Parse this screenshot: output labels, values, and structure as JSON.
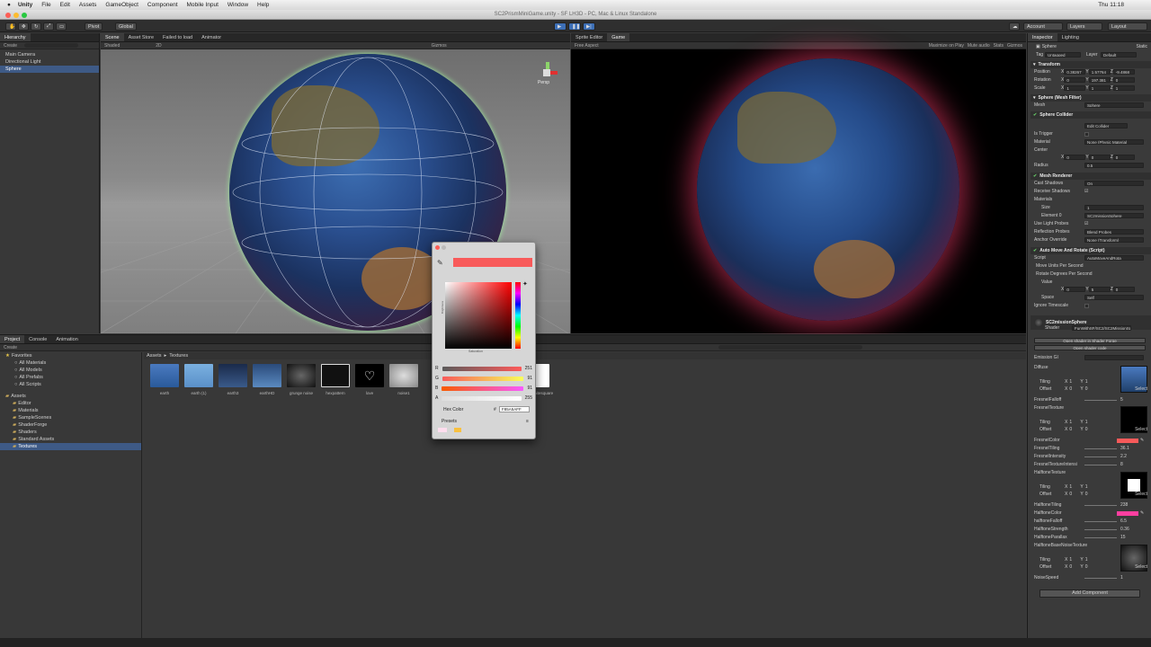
{
  "menubar": {
    "app": "Unity",
    "items": [
      "File",
      "Edit",
      "Assets",
      "GameObject",
      "Component",
      "Mobile Input",
      "Window",
      "Help"
    ],
    "title": "SC2PrismMiniGame.unity - SF LH3D - PC, Mac & Linux Standalone",
    "time": "Thu 11:18"
  },
  "toolbar": {
    "pivot": "Pivot",
    "global": "Global",
    "account": "Account",
    "layers": "Layers",
    "layout": "Layout"
  },
  "hierarchy": {
    "tab": "Hierarchy",
    "create": "Create",
    "items": [
      "Main Camera",
      "Directional Light",
      "Sphere"
    ]
  },
  "scene": {
    "tabs": [
      "Scene",
      "Asset Store",
      "Failed to load",
      "Animator"
    ],
    "shading": "Shaded",
    "mode": "2D",
    "gizmos": "Gizmos",
    "persp": "Persp"
  },
  "game": {
    "tabs": [
      "Sprite Editor",
      "Game"
    ],
    "aspect": "Free Aspect",
    "options": [
      "Maximize on Play",
      "Mute audio",
      "Stats",
      "Gizmos"
    ]
  },
  "project": {
    "tabs": [
      "Project",
      "Console",
      "Animation"
    ],
    "create": "Create",
    "favorites": "Favorites",
    "fav_items": [
      "All Materials",
      "All Models",
      "All Prefabs",
      "All Scripts"
    ],
    "assets": "Assets",
    "folders": [
      "Editor",
      "Materials",
      "SampleScenes",
      "ShaderForge",
      "Shaders",
      "Standard Assets",
      "Textures"
    ],
    "breadcrumb": [
      "Assets",
      "Textures"
    ],
    "thumbnails": [
      "earth",
      "earth (1)",
      "earth3",
      "earthHD",
      "grunge noise",
      "hexpattern",
      "love",
      "noise1",
      "",
      "whitesquare"
    ]
  },
  "color_picker": {
    "hex_label": "Hex Color",
    "hex_value": "F85A5AFF",
    "rgba": [
      {
        "channel": "R",
        "value": "251"
      },
      {
        "channel": "G",
        "value": "91"
      },
      {
        "channel": "B",
        "value": "91"
      },
      {
        "channel": "A",
        "value": "255"
      }
    ],
    "presets": "Presets",
    "saturation": "Saturation",
    "brightness": "Brightness",
    "current_color": "#f85a5a"
  },
  "inspector": {
    "tabs": [
      "Inspector",
      "Lighting"
    ],
    "object_name": "Sphere",
    "static": "Static",
    "tag_label": "Tag",
    "tag": "Untagged",
    "layer_label": "Layer",
    "layer": "Default",
    "transform": {
      "title": "Transform",
      "position": {
        "label": "Position",
        "x": "0.38267",
        "y": "1.57764",
        "z": "-9.4868"
      },
      "rotation": {
        "label": "Rotation",
        "x": "0",
        "y": "197.381",
        "z": "0"
      },
      "scale": {
        "label": "Scale",
        "x": "1",
        "y": "1",
        "z": "1"
      }
    },
    "mesh_filter": {
      "title": "Sphere (Mesh Filter)",
      "label": "Mesh",
      "value": "Sphere"
    },
    "collider": {
      "title": "Sphere Collider",
      "edit": "Edit Collider",
      "is_trigger": "Is Trigger",
      "material_label": "Material",
      "material": "None (Physic Material",
      "center": "Center",
      "cx": "0",
      "cy": "0",
      "cz": "0",
      "radius_label": "Radius",
      "radius": "0.5"
    },
    "renderer": {
      "title": "Mesh Renderer",
      "cast_shadows": "Cast Shadows",
      "cast_value": "On",
      "receive": "Receive Shadows",
      "materials": "Materials",
      "size_label": "Size",
      "size": "1",
      "element_label": "Element 0",
      "element": "SC2missionSphere",
      "light_probes": "Use Light Probes",
      "reflection_label": "Reflection Probes",
      "reflection": "Blend Probes",
      "anchor_label": "Anchor Override",
      "anchor": "None (Transform)"
    },
    "script": {
      "title": "Auto Move And Rotate (Script)",
      "script_label": "Script",
      "script": "AutoMoveAndRota",
      "move": "Move Units Per Second",
      "rotate": "Rotate Degrees Per Second",
      "value": "Value",
      "vx": "0",
      "vy": "5",
      "vz": "0",
      "space_label": "Space",
      "space": "Self",
      "ignore": "Ignore Timescale"
    },
    "material": {
      "name": "SC2missionSphere",
      "shader_label": "Shader",
      "shader": "FunWithSF/SC2/SC2MissionSph",
      "open_sf": "Open shader in Shader Forge",
      "open_code": "Open shader code",
      "emission": "Emission GI",
      "diffuse": "Diffuse",
      "tiling": "Tiling",
      "offset": "Offset",
      "fresnel_falloff": "FresnelFalloff",
      "fresnel_falloff_v": "5",
      "fresnel_texture": "FresnelTexture",
      "fresnel_color": "FresnelColor",
      "fresnel_tiling": "FresnelTiling",
      "fresnel_tiling_v": "36.1",
      "fresnel_intensity": "FresnelIntensity",
      "fresnel_intensity_v": "2.2",
      "fresnel_tex_intensity": "FresnelTextureIntensi",
      "fresnel_tex_intensity_v": "8",
      "halftone_texture": "HalftoneTexture",
      "halftone_tiling": "HalftoneTiling",
      "halftone_tiling_v": "238",
      "halftone_color": "HalftoneColor",
      "halftone_falloff": "halftoneFalloff",
      "halftone_falloff_v": "6.5",
      "halftone_strength": "HalftoneStrength",
      "halftone_strength_v": "0.36",
      "halftone_parallax": "HalftoneParallax",
      "halftone_parallax_v": "15",
      "halftone_noise": "HalftoneBaseNoiseTexture",
      "noise_speed": "NoiseSpeed",
      "noise_speed_v": "1",
      "select": "Select",
      "one": "1",
      "zero": "0"
    },
    "add_component": "Add Component"
  }
}
